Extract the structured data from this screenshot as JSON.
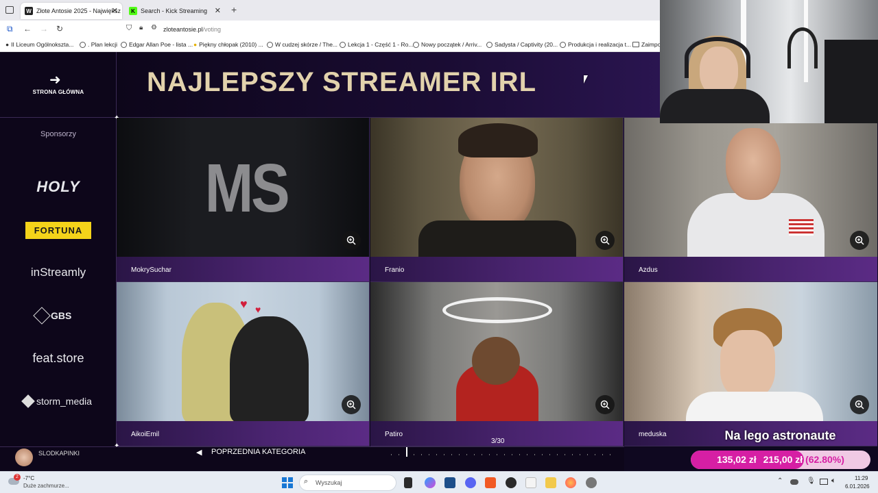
{
  "browser": {
    "tabs": [
      {
        "title": "Złote Antosie 2025 - Największ",
        "active": true
      },
      {
        "title": "Search - Kick Streaming",
        "active": false
      }
    ],
    "new_tab": "+",
    "url_domain": "zloteantosie.pl",
    "url_path": "/voting",
    "bookmarks": [
      "II Liceum Ogólnokszta...",
      ". Plan lekcji",
      "Edgar Allan Poe - lista ...",
      "Piękny chłopak (2010) ...",
      "W cudzej skórze / The...",
      "Lekcja 1 - Część 1 - Ro...",
      "Nowy początek / Arriv...",
      "Sadysta / Captivity (20...",
      "Produkcja i realizacja t...",
      "Zaimpo"
    ]
  },
  "page": {
    "home_label": "STRONA GŁÓWNA",
    "sponsors_title": "Sponsorzy",
    "sponsors": [
      "HOLY",
      "FORTUNA",
      "inStreamly",
      "GBS",
      "feat.store",
      "storm_media"
    ],
    "category_title": "NAJLEPSZY STREAMER IRL",
    "nominees": [
      "MokrySuchar",
      "Franio",
      "Azdus",
      "AikoiEmil",
      "Patiro",
      "meduska"
    ],
    "ms_logo_text": "MS",
    "prev_category": "POPRZEDNIA KATEGORIA",
    "pager": "3/30",
    "user_name": "SLODKAPINKI"
  },
  "overlay": {
    "donation_title": "Na lego astronaute",
    "donation_current": "135,02 zł",
    "donation_goal": "215,00 zł",
    "donation_percent": "(62.80%)",
    "donation_progress": 0.628
  },
  "taskbar": {
    "weather_temp": "-7°C",
    "weather_desc": "Duże zachmurze...",
    "weather_badge": "2",
    "search_placeholder": "Wyszukaj",
    "time": "11:29",
    "date": "6.01.2026"
  },
  "colors": {
    "accent_title": "#e2d2ac",
    "page_bg": "#0f0820",
    "namebar_purple": "#4a2470",
    "donation_pink": "#d61fa4"
  }
}
